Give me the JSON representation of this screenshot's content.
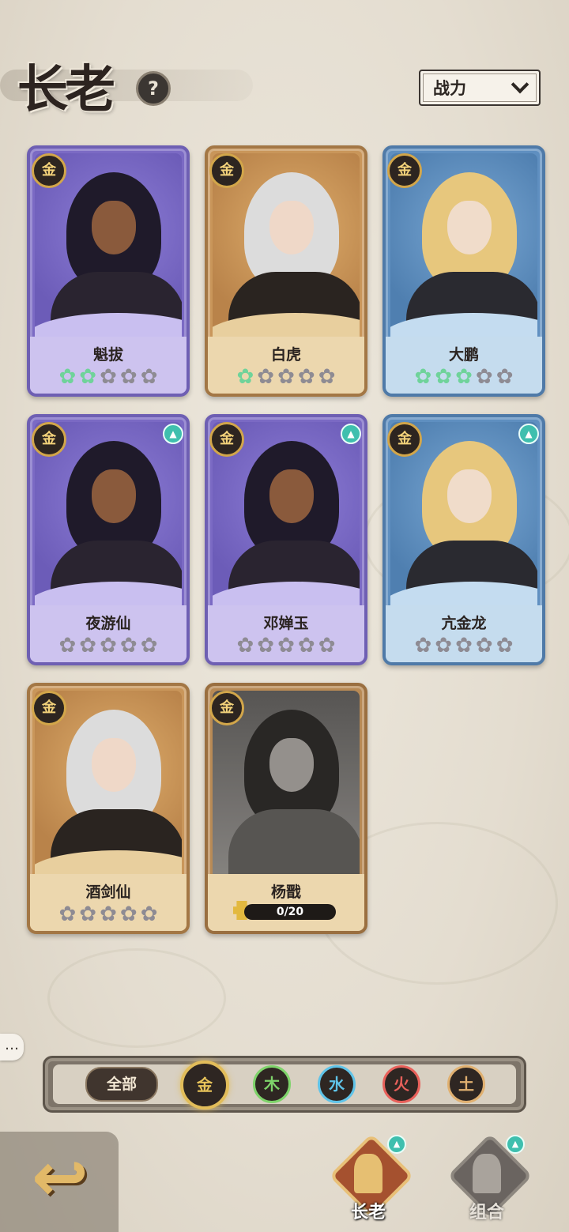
{
  "header": {
    "title": "长老",
    "help_icon": "?",
    "sort": {
      "selected": "战力"
    }
  },
  "cards": [
    {
      "name": "魁拔",
      "element": "金",
      "theme": "purple",
      "stars_on": 2,
      "stars_total": 5,
      "upgrade": false
    },
    {
      "name": "白虎",
      "element": "金",
      "theme": "tan",
      "stars_on": 1,
      "stars_total": 5,
      "upgrade": false
    },
    {
      "name": "大鹏",
      "element": "金",
      "theme": "blue",
      "stars_on": 3,
      "stars_total": 5,
      "upgrade": false
    },
    {
      "name": "夜游仙",
      "element": "金",
      "theme": "purple",
      "stars_on": 0,
      "stars_total": 5,
      "upgrade": true
    },
    {
      "name": "邓婵玉",
      "element": "金",
      "theme": "purple",
      "stars_on": 0,
      "stars_total": 5,
      "upgrade": true
    },
    {
      "name": "亢金龙",
      "element": "金",
      "theme": "blue",
      "stars_on": 0,
      "stars_total": 5,
      "upgrade": true
    },
    {
      "name": "酒剑仙",
      "element": "金",
      "theme": "tan",
      "stars_on": 0,
      "stars_total": 5,
      "upgrade": false
    },
    {
      "name": "杨戬",
      "element": "金",
      "theme": "gray",
      "shards": "0/20",
      "locked": true
    }
  ],
  "filters": {
    "all_label": "全部",
    "elements": [
      {
        "label": "金",
        "color": "#e7c35a",
        "selected": true
      },
      {
        "label": "木",
        "color": "#7ed36a",
        "selected": false
      },
      {
        "label": "水",
        "color": "#5fc3e8",
        "selected": false
      },
      {
        "label": "火",
        "color": "#e8605a",
        "selected": false
      },
      {
        "label": "土",
        "color": "#e0b070",
        "selected": false
      }
    ]
  },
  "nav": {
    "back_icon": "back-arrow-icon",
    "tabs": [
      {
        "label": "长老",
        "active": true,
        "upgrade": true
      },
      {
        "label": "组合",
        "active": false,
        "upgrade": true
      }
    ]
  }
}
